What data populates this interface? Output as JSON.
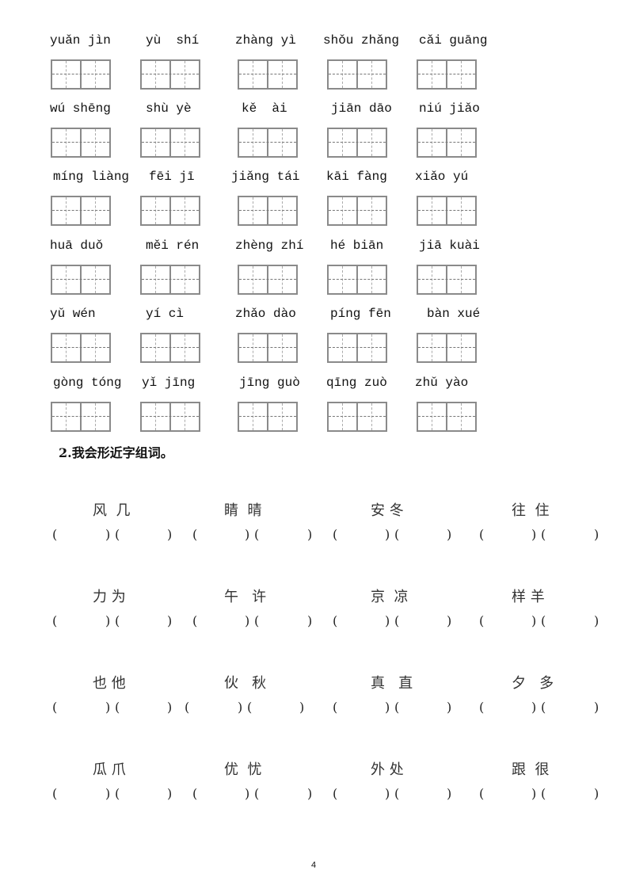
{
  "pinyin_section": {
    "rows": [
      [
        "yuǎn jìn",
        "yù  shí",
        "zhàng yì",
        "shǒu zhǎng",
        "cǎi guāng"
      ],
      [
        "wú shēng",
        "shù yè",
        "kě  ài",
        "jiān dāo",
        "niú jiǎo"
      ],
      [
        "míng liàng",
        "fēi jī",
        "jiǎng tái",
        "kāi fàng",
        "xiǎo yú"
      ],
      [
        "huā duǒ",
        "měi rén",
        "zhèng zhí",
        "hé biān",
        "jiā kuài"
      ],
      [
        "yǔ wén",
        "yí cì",
        "zhǎo dào",
        "píng fēn",
        "bàn xué"
      ],
      [
        "gòng tóng",
        "yǐ jīng",
        "jīng guò",
        "qīng zuò",
        "zhǔ yào"
      ]
    ]
  },
  "section2": {
    "title": "2.我会形近字组词。",
    "rows": [
      [
        "风  几",
        "睛  晴",
        "安 冬",
        "往  住"
      ],
      [
        "力 为",
        "午   许",
        "京  凉",
        "样 羊"
      ],
      [
        "也 他",
        "伙   秋",
        "真   直",
        "夕   多"
      ],
      [
        "瓜 爪",
        "优  忧",
        "外 处",
        "跟  很"
      ]
    ],
    "paren_open": "(",
    "paren_close": ")"
  },
  "page_number": "4"
}
